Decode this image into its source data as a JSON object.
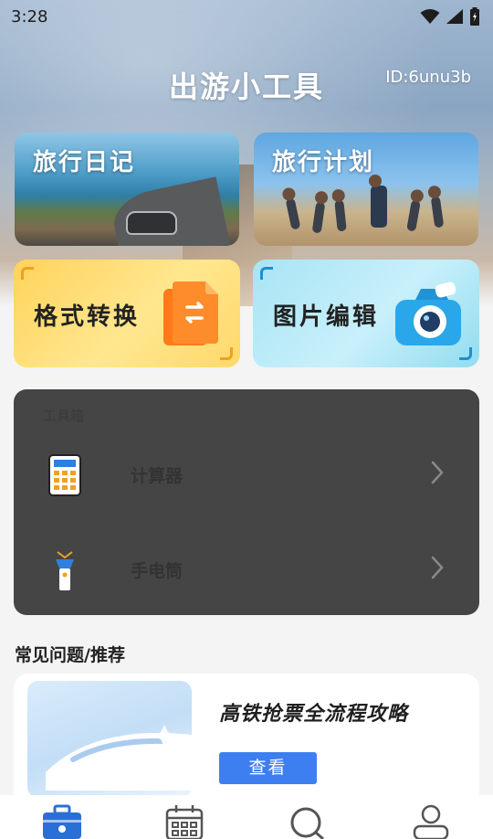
{
  "status_bar": {
    "time": "3:28",
    "icons": [
      "wifi-icon",
      "cell-signal-icon",
      "battery-icon"
    ]
  },
  "header": {
    "title": "出游小工具",
    "user_id": "ID:6unu3b"
  },
  "feature_cards": [
    {
      "title": "旅行日记"
    },
    {
      "title": "旅行计划"
    }
  ],
  "tool_cards": [
    {
      "title": "格式转换",
      "icon": "file-convert-icon",
      "accent": "#f0a020"
    },
    {
      "title": "图片编辑",
      "icon": "camera-icon",
      "accent": "#1a8fd6"
    }
  ],
  "toolbox": {
    "label": "工具箱",
    "items": [
      {
        "label": "计算器",
        "icon": "calculator-icon"
      },
      {
        "label": "手电筒",
        "icon": "flashlight-icon"
      }
    ]
  },
  "recommend": {
    "section_title": "常见问题/推荐",
    "card": {
      "title": "高铁抢票全流程攻略",
      "button": "查看"
    }
  },
  "bottom_nav": [
    {
      "icon": "toolbox-icon",
      "active": true
    },
    {
      "icon": "calendar-icon",
      "active": false
    },
    {
      "icon": "search-icon",
      "active": false
    },
    {
      "icon": "profile-icon",
      "active": false
    }
  ],
  "colors": {
    "primary": "#3d7ff0",
    "panel": "#454545",
    "nav_active": "#2a6fd6"
  }
}
